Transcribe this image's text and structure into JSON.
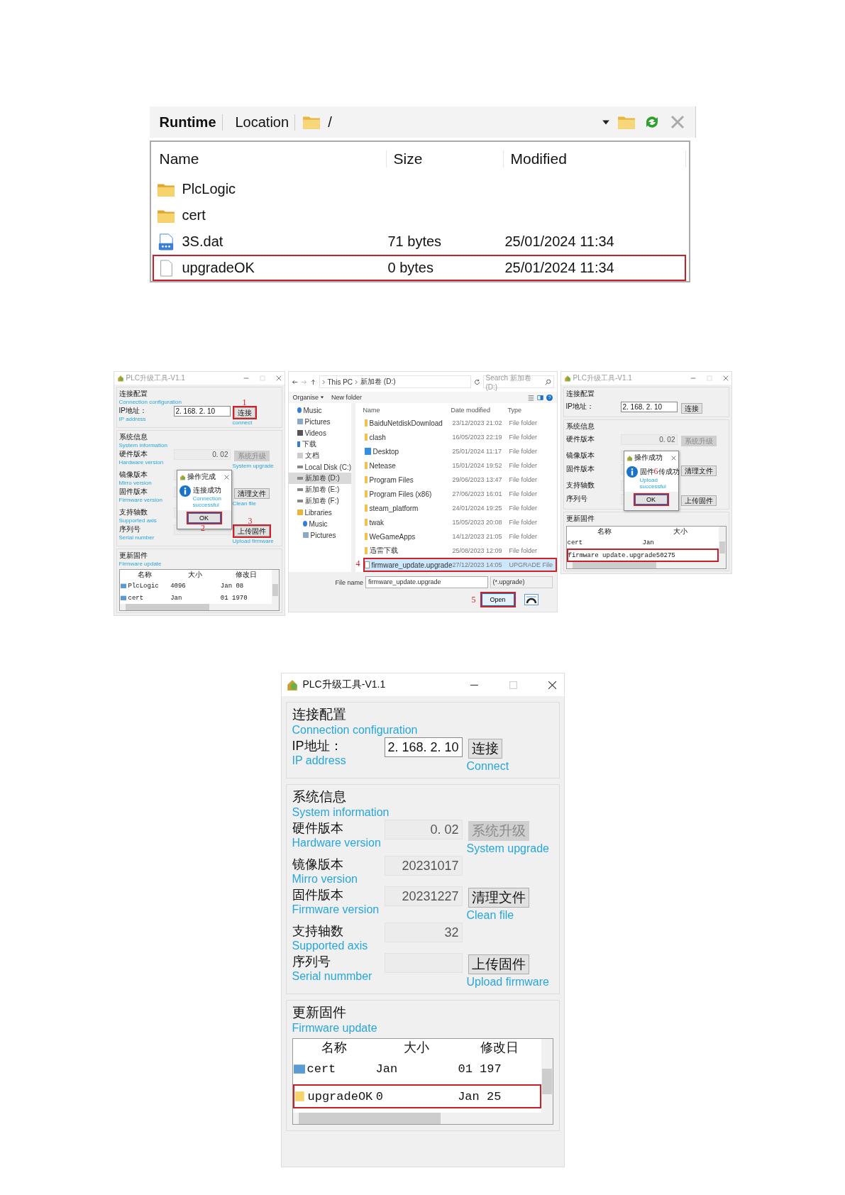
{
  "figures": [
    {
      "kind": "file_browser",
      "tabs": [
        {
          "label": "Runtime",
          "selected": true
        },
        {
          "label": "Location",
          "selected": false
        }
      ],
      "path": "/",
      "columns": [
        "Name",
        "Size",
        "Modified"
      ],
      "rows": [
        {
          "kind": "folder",
          "name": "PlcLogic",
          "highlighted": false
        },
        {
          "kind": "folder",
          "name": "cert",
          "highlighted": false
        },
        {
          "kind": "data",
          "name": "3S.dat",
          "size": "71 bytes",
          "modified": "25/01/2024 11:34",
          "highlighted": false
        },
        {
          "kind": "file",
          "name": "upgradeOK",
          "size": "0 bytes",
          "modified": "25/01/2024 11:34",
          "highlighted": true
        }
      ]
    },
    {
      "kind": "steps",
      "panels": [
        {
          "kind": "tool_window",
          "title": "PLC升级工具-V1.1",
          "sections": [
            {
              "heading": "连接配置",
              "heading_en": "Connection configuration",
              "rows": [
                {
                  "label": "IP地址：",
                  "label_en": "IP address",
                  "value": "2. 168. 2. 10",
                  "editable": true,
                  "button": "连接",
                  "button_en": "connect",
                  "button_disabled": false,
                  "marker": "1"
                }
              ]
            },
            {
              "heading": "系统信息",
              "heading_en": "System information",
              "rows": [
                {
                  "label": "硬件版本",
                  "label_en": "Hardware version",
                  "value": "0. 02",
                  "editable": false,
                  "button": "系统升级",
                  "button_en": "System upgrade",
                  "button_disabled": true
                },
                {
                  "label": "镜像版本",
                  "label_en": "Mirro version",
                  "editable": false
                },
                {
                  "label": "固件版本",
                  "label_en": "Firmware version",
                  "editable": false,
                  "button": "清理文件",
                  "button_en": "Clean file",
                  "button_disabled": false
                },
                {
                  "label": "支持轴数",
                  "label_en": "Supported axis",
                  "editable": false
                },
                {
                  "label": "序列号",
                  "label_en": "Serial number",
                  "editable": false,
                  "button": "上传固件",
                  "button_en": "Upload firmware",
                  "button_disabled": false,
                  "marker": "3"
                }
              ]
            },
            {
              "heading": "更新固件",
              "heading_en": "Firmware update",
              "table": {
                "columns": [
                  "名称",
                  "大小",
                  "修改日"
                ],
                "rows": [
                  {
                    "kind": "folder",
                    "cells": [
                      "PlcLogic",
                      "4096",
                      "Jan 08"
                    ],
                    "highlighted": false
                  },
                  {
                    "kind": "folder",
                    "cells": [
                      "cert",
                      "Jan",
                      "01  1970"
                    ],
                    "highlighted": false
                  }
                ]
              }
            }
          ],
          "dialog": {
            "title": "操作完成",
            "message": [
              "连接成功"
            ],
            "message_en": "Connection successful",
            "button": "OK",
            "ok_boxed": true,
            "marker": "2"
          }
        },
        {
          "kind": "file_dialog",
          "breadcrumb": [
            "This PC",
            "新加卷 (D:)"
          ],
          "search_placeholder": "Search 新加卷 (D:)",
          "toolbar": [
            "Organise",
            "New folder"
          ],
          "sidebar": [
            {
              "kind": "music",
              "label": "Music",
              "selected": false
            },
            {
              "kind": "pictures",
              "label": "Pictures",
              "selected": false
            },
            {
              "kind": "videos",
              "label": "Videos",
              "selected": false
            },
            {
              "kind": "download",
              "label": "下载",
              "selected": false
            },
            {
              "kind": "docs",
              "label": "文档",
              "selected": false
            },
            {
              "kind": "drive",
              "label": "Local Disk (C:)",
              "selected": false
            },
            {
              "kind": "drive",
              "label": "新加卷 (D:)",
              "selected": true
            },
            {
              "kind": "drive",
              "label": "新加卷 (E:)",
              "selected": false
            },
            {
              "kind": "drive",
              "label": "新加卷 (F:)",
              "selected": false
            },
            {
              "kind": "library",
              "label": "Libraries",
              "selected": false,
              "children": [
                {
                  "kind": "music",
                  "label": "Music",
                  "selected": false
                },
                {
                  "kind": "pictures",
                  "label": "Pictures",
                  "selected": false
                }
              ]
            }
          ],
          "columns": [
            "Name",
            "Date modified",
            "Type"
          ],
          "rows": [
            {
              "kind": "folder",
              "name": "BaiduNetdiskDownload",
              "date": "23/12/2023 21:02",
              "type": "File folder",
              "selected": false
            },
            {
              "kind": "folder",
              "name": "clash",
              "date": "16/05/2023 22:19",
              "type": "File folder",
              "selected": false
            },
            {
              "kind": "desktop",
              "name": "Desktop",
              "date": "25/01/2024 11:17",
              "type": "File folder",
              "selected": false
            },
            {
              "kind": "folder",
              "name": "Netease",
              "date": "15/01/2024 19:52",
              "type": "File folder",
              "selected": false
            },
            {
              "kind": "folder",
              "name": "Program Files",
              "date": "29/06/2023 13:47",
              "type": "File folder",
              "selected": false
            },
            {
              "kind": "folder",
              "name": "Program Files (x86)",
              "date": "27/06/2023 16:01",
              "type": "File folder",
              "selected": false
            },
            {
              "kind": "folder",
              "name": "steam_platform",
              "date": "24/01/2024 19:25",
              "type": "File folder",
              "selected": false
            },
            {
              "kind": "folder",
              "name": "twak",
              "date": "15/05/2023 20:08",
              "type": "File folder",
              "selected": false
            },
            {
              "kind": "folder",
              "name": "WeGameApps",
              "date": "14/12/2023 21:05",
              "type": "File folder",
              "selected": false
            },
            {
              "kind": "folder",
              "name": "迅雷下载",
              "date": "25/08/2023 12:09",
              "type": "File folder",
              "selected": false
            },
            {
              "kind": "file",
              "name": "firmware_update.upgrade",
              "date": "27/12/2023 14:05",
              "type": "UPGRADE File",
              "selected": true,
              "marker": "4"
            }
          ],
          "file_name_label": "File name",
          "file_name": "firmware_update.upgrade",
          "filter": "(*.upgrade)",
          "open_button": "Open",
          "open_marker": "5"
        },
        {
          "kind": "tool_window",
          "title": "PLC升级工具-V1.1",
          "sections": [
            {
              "heading": "连接配置",
              "rows": [
                {
                  "label": "IP地址：",
                  "value": "2. 168. 2. 10",
                  "editable": true,
                  "button": "连接",
                  "button_disabled": false
                }
              ]
            },
            {
              "heading": "系统信息",
              "rows": [
                {
                  "label": "硬件版本",
                  "value": "0. 02",
                  "editable": false,
                  "button": "系统升级",
                  "button_disabled": true
                },
                {
                  "label": "镜像版本",
                  "editable": false
                },
                {
                  "label": "固件版本",
                  "editable": false,
                  "button": "清理文件",
                  "button_disabled": false
                },
                {
                  "label": "支持轴数",
                  "editable": false
                },
                {
                  "label": "序列号",
                  "editable": false,
                  "button": "上传固件",
                  "button_disabled": false
                }
              ]
            },
            {
              "heading": "更新固件",
              "table": {
                "columns": [
                  "名称",
                  "大小"
                ],
                "rows": [
                  {
                    "kind": "plain",
                    "cells": [
                      "cert",
                      "Jan"
                    ],
                    "highlighted": false
                  },
                  {
                    "kind": "plain",
                    "cells": [
                      "firmware update.upgrade",
                      "50275"
                    ],
                    "highlighted": true
                  }
                ]
              }
            }
          ],
          "dialog": {
            "title": "操作成功",
            "message": [
              "固件",
              "传成功"
            ],
            "message_marker": "6",
            "message_en": "Upload successful",
            "button": "OK",
            "ok_boxed": true
          }
        }
      ]
    },
    {
      "kind": "steps",
      "panels": [
        {
          "kind": "tool_window",
          "title": "PLC升级工具-V1.1",
          "sections": [
            {
              "heading": "连接配置",
              "heading_en": "Connection configuration",
              "rows": [
                {
                  "label": "IP地址：",
                  "label_en": "IP address",
                  "value": "2. 168. 2. 10",
                  "editable": true,
                  "button": "连接",
                  "button_en": "Connect",
                  "button_disabled": false
                }
              ]
            },
            {
              "heading": "系统信息",
              "heading_en": "System information",
              "rows": [
                {
                  "label": "硬件版本",
                  "label_en": "Hardware version",
                  "value": "0. 02",
                  "editable": false,
                  "button": "系统升级",
                  "button_en": "System upgrade",
                  "button_disabled": true
                },
                {
                  "label": "镜像版本",
                  "label_en": "Mirro version",
                  "value": "20231017",
                  "editable": false
                },
                {
                  "label": "固件版本",
                  "label_en": "Firmware version",
                  "value": "20231227",
                  "editable": false,
                  "button": "清理文件",
                  "button_en": "Clean file",
                  "button_disabled": false
                },
                {
                  "label": "支持轴数",
                  "label_en": "Supported axis",
                  "value": "32",
                  "editable": false
                },
                {
                  "label": "序列号",
                  "label_en": "Serial nummber",
                  "editable": false,
                  "button": "上传固件",
                  "button_en": "Upload firmware",
                  "button_disabled": false
                }
              ]
            },
            {
              "heading": "更新固件",
              "heading_en": "Firmware update",
              "table": {
                "columns": [
                  "名称",
                  "大小",
                  "修改日"
                ],
                "rows": [
                  {
                    "kind": "folder",
                    "cells": [
                      "cert",
                      "Jan",
                      "01  197"
                    ],
                    "highlighted": false
                  },
                  {
                    "kind": "file",
                    "cells": [
                      "upgradeOK",
                      "0",
                      "Jan  25"
                    ],
                    "highlighted": true
                  }
                ]
              }
            }
          ]
        }
      ]
    }
  ]
}
